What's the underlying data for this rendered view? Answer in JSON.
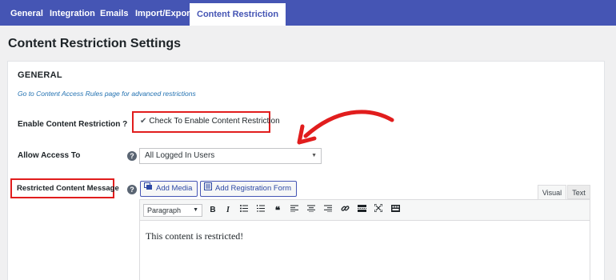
{
  "tabs": [
    {
      "label": "General"
    },
    {
      "label": "Integration"
    },
    {
      "label": "Emails"
    },
    {
      "label": "Import/Export"
    },
    {
      "label": "Content Restriction"
    }
  ],
  "active_tab": "Content Restriction",
  "page": {
    "title": "Content Restriction Settings"
  },
  "section": {
    "heading": "GENERAL",
    "link": "Go to Content Access Rules page for advanced restrictions"
  },
  "enable": {
    "label": "Enable Content Restriction ?",
    "checkbox_label": "Check To Enable Content Restriction",
    "checked": true
  },
  "access": {
    "label": "Allow Access To",
    "value": "All Logged In Users",
    "help": "?"
  },
  "message": {
    "label": "Restricted Content Message",
    "help": "?",
    "add_media": "Add Media",
    "add_registration": "Add Registration Form",
    "tab_visual": "Visual",
    "tab_text": "Text",
    "format": "Paragraph",
    "content": "This content is restricted!"
  },
  "toolbar": {
    "bold": "B",
    "italic": "I",
    "quote": "❝"
  },
  "colors": {
    "accent": "#4555b4",
    "highlight": "#e11d1d",
    "link": "#2271b1"
  }
}
